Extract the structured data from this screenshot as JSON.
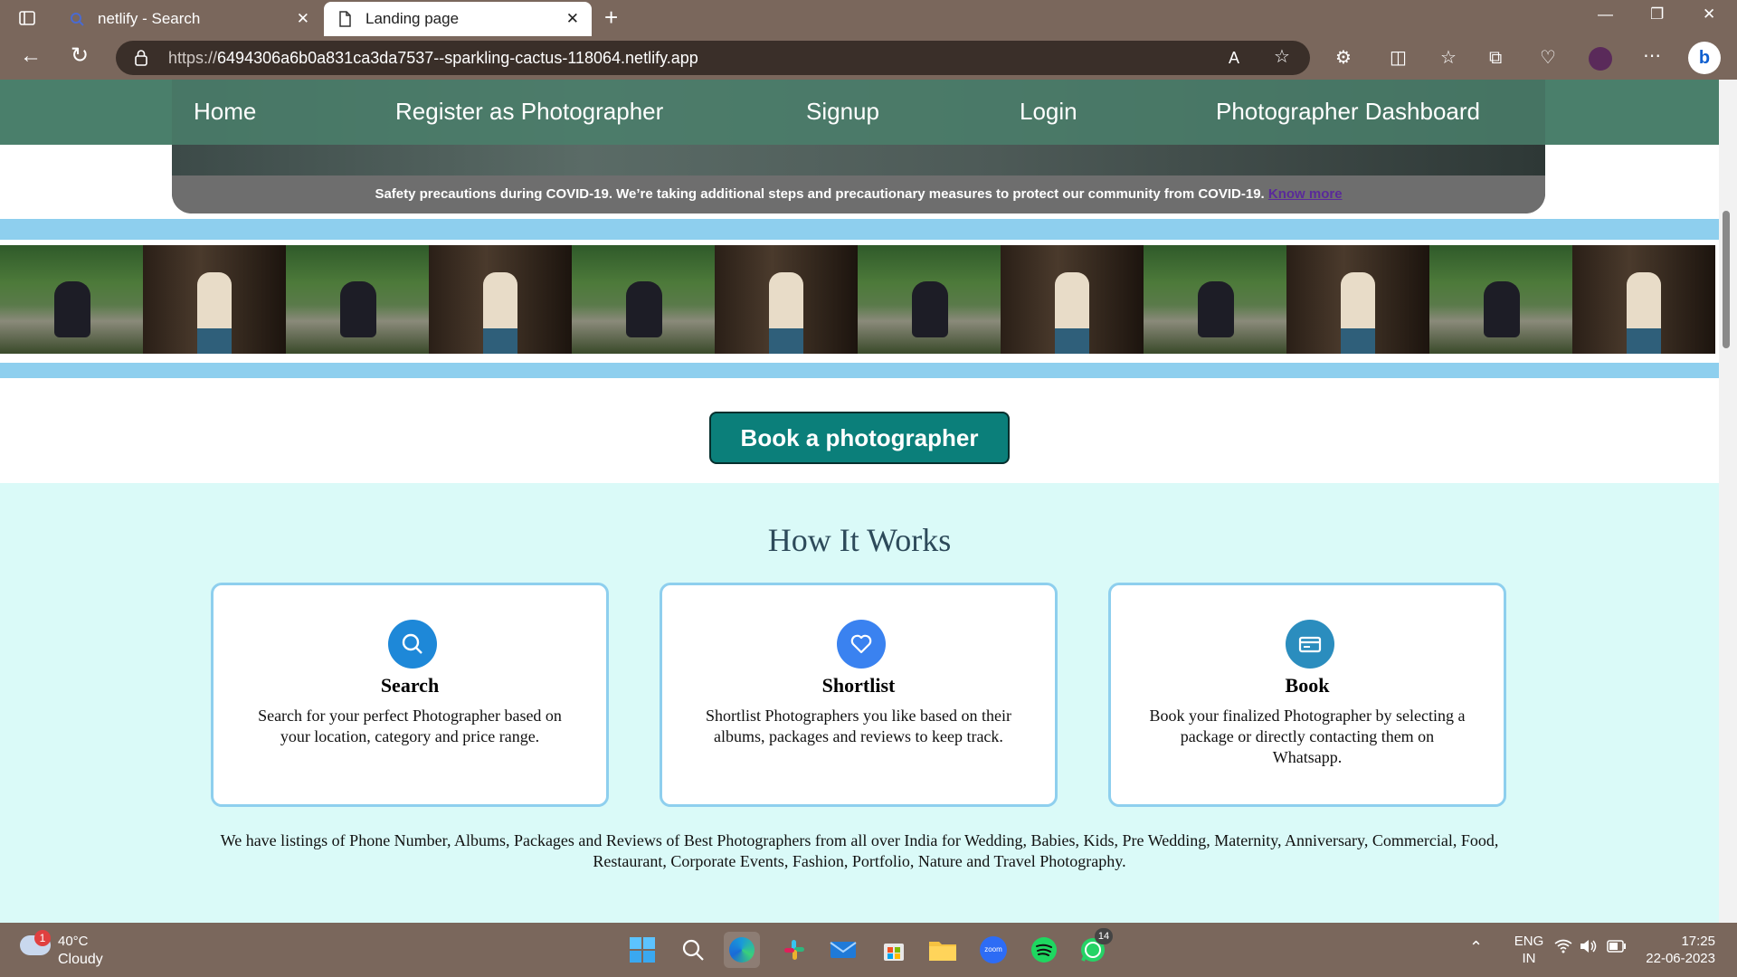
{
  "browser": {
    "tabs": [
      {
        "label": "netlify - Search",
        "icon": "search-favicon"
      },
      {
        "label": "Landing page",
        "icon": "page-icon"
      }
    ],
    "url_scheme": "https://",
    "url_host": "6494306a6b0a831ca3da7537--sparkling-cactus-118064.netlify.app"
  },
  "nav": {
    "items": [
      "Home",
      "Register as Photographer",
      "Signup",
      "Login",
      "Photographer Dashboard"
    ]
  },
  "covid": {
    "text": "Safety precautions during COVID-19. We’re taking additional steps and precautionary measures to protect our community from COVID-19.",
    "link": "Know more"
  },
  "book_button": "Book a photographer",
  "how": {
    "title": "How It Works",
    "cards": [
      {
        "title": "Search",
        "text": "Search for your perfect Photographer based on your location, category and price range.",
        "icon": "search-icon",
        "color": "#1e88d8"
      },
      {
        "title": "Shortlist",
        "text": "Shortlist Photographers you like based on their albums, packages and reviews to keep track.",
        "icon": "heart-icon",
        "color": "#3a82f0"
      },
      {
        "title": "Book",
        "text": "Book your finalized Photographer by selecting a package or directly contacting them on Whatsapp.",
        "icon": "card-icon",
        "color": "#2b8dbe"
      }
    ],
    "listing": "We have listings of Phone Number, Albums, Packages and Reviews of Best Photographers from all over India for Wedding, Babies, Kids, Pre Wedding, Maternity, Anniversary, Commercial, Food, Restaurant, Corporate Events, Fashion, Portfolio, Nature and Travel Photography."
  },
  "taskbar": {
    "weather_badge": "1",
    "temp": "40°C",
    "condition": "Cloudy",
    "lang1": "ENG",
    "lang2": "IN",
    "time": "17:25",
    "date": "22-06-2023",
    "whatsapp_badge": "14"
  },
  "colors": {
    "brand_teal": "#0b7f7a",
    "accent_blue": "#8ecfee",
    "nav_green": "#4a7f6b",
    "section_bg": "#dafaf8"
  }
}
